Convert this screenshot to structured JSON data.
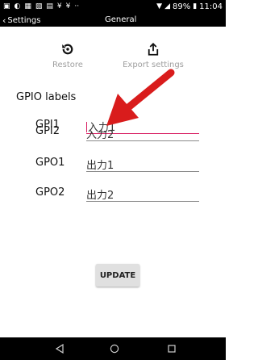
{
  "status_bar": {
    "battery": "89%",
    "time": "11:04"
  },
  "app_bar": {
    "back_label": "Settings",
    "title": "General"
  },
  "actions": {
    "restore_label": "Restore",
    "export_label": "Export settings"
  },
  "gpio": {
    "heading": "GPIO labels",
    "rows": [
      {
        "name": "GPI1",
        "value": "入力1"
      },
      {
        "name": "GPI2",
        "value": "入力2"
      },
      {
        "name": "GPO1",
        "value": "出力1"
      },
      {
        "name": "GPO2",
        "value": "出力2"
      }
    ]
  },
  "update_label": "UPDATE",
  "colors": {
    "accent": "#d81b60",
    "arrow": "#d91c1c",
    "bar_background": "#000000"
  },
  "icons": {
    "restore": "restore-icon",
    "export": "share-upload-icon",
    "back": "chevron-left-icon"
  }
}
